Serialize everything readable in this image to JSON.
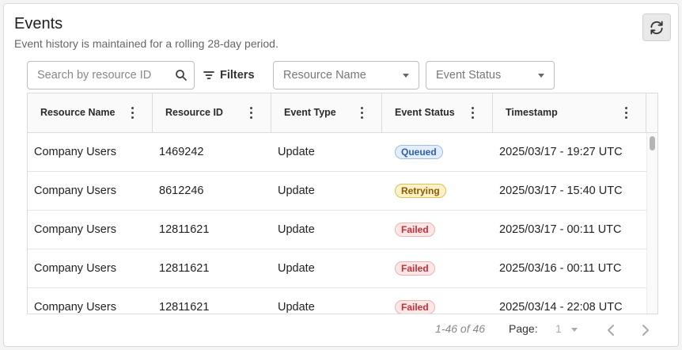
{
  "header": {
    "title": "Events",
    "subtitle": "Event history is maintained for a rolling 28-day period."
  },
  "toolbar": {
    "search_placeholder": "Search by resource ID",
    "filters_label": "Filters",
    "resource_name_select": "Resource Name",
    "event_status_select": "Event Status"
  },
  "table": {
    "columns": [
      "Resource Name",
      "Resource ID",
      "Event Type",
      "Event Status",
      "Timestamp"
    ],
    "rows": [
      {
        "resource_name": "Company Users",
        "resource_id": "1469242",
        "event_type": "Update",
        "status": "Queued",
        "timestamp": "2025/03/17 - 19:27 UTC"
      },
      {
        "resource_name": "Company Users",
        "resource_id": "8612246",
        "event_type": "Update",
        "status": "Retrying",
        "timestamp": "2025/03/17 - 15:40 UTC"
      },
      {
        "resource_name": "Company Users",
        "resource_id": "12811621",
        "event_type": "Update",
        "status": "Failed",
        "timestamp": "2025/03/17 - 00:11 UTC"
      },
      {
        "resource_name": "Company Users",
        "resource_id": "12811621",
        "event_type": "Update",
        "status": "Failed",
        "timestamp": "2025/03/16 - 00:11 UTC"
      },
      {
        "resource_name": "Company Users",
        "resource_id": "12811621",
        "event_type": "Update",
        "status": "Failed",
        "timestamp": "2025/03/14 - 22:08 UTC"
      }
    ]
  },
  "status_colors": {
    "Queued": {
      "bg": "#e3edfb",
      "border": "#9fbdea",
      "text": "#2c5fae"
    },
    "Retrying": {
      "bg": "#fdf1c7",
      "border": "#e2bd4f",
      "text": "#8a5a00"
    },
    "Failed": {
      "bg": "#fde6e6",
      "border": "#efb1b1",
      "text": "#c0303a"
    }
  },
  "pagination": {
    "count": "1-46 of 46",
    "page_label": "Page:",
    "page_value": "1"
  },
  "icons": {
    "refresh": "refresh-icon",
    "search": "search-icon",
    "filter": "filter-icon",
    "kebab": "more-vertical-icon",
    "prev": "chevron-left-icon",
    "next": "chevron-right-icon"
  }
}
